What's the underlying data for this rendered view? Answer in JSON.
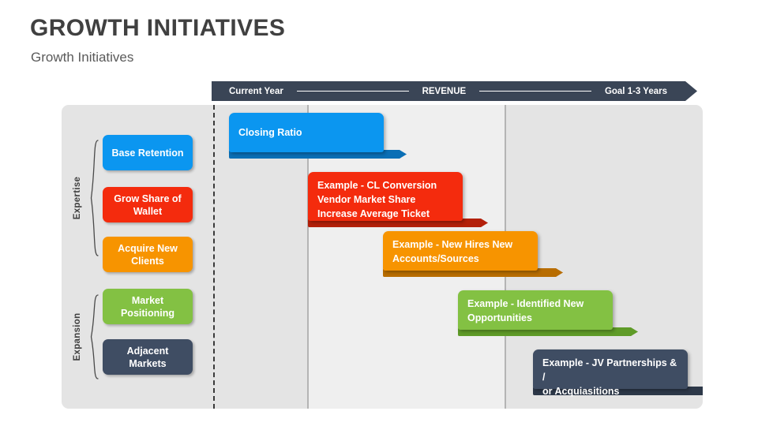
{
  "title": "GROWTH INITIATIVES",
  "subtitle": "Growth Initiatives",
  "banner": {
    "left_label": "Current Year",
    "center_label": "REVENUE",
    "right_label": "Goal 1-3 Years",
    "color": "#3a4556"
  },
  "groups": [
    {
      "label": "Expertise"
    },
    {
      "label": "Expansion"
    }
  ],
  "categories": [
    {
      "label": "Base Retention",
      "color": "#0b96f0",
      "dark": "#0b6fb5"
    },
    {
      "label": "Grow Share of Wallet",
      "color": "#f42b0d",
      "dark": "#b3200a"
    },
    {
      "label": "Acquire New Clients",
      "color": "#f79400",
      "dark": "#b86d00"
    },
    {
      "label": "Market Positioning",
      "color": "#83c143",
      "dark": "#5f9b28"
    },
    {
      "label": "Adjacent Markets",
      "color": "#3f4d63",
      "dark": "#2d3849"
    }
  ],
  "initiatives": [
    {
      "lines": [
        "Closing Ratio"
      ],
      "color": "#0b96f0",
      "dark": "#0b6fb5"
    },
    {
      "lines": [
        "Example - CL Conversion",
        "Vendor Market Share",
        "Increase Average Ticket"
      ],
      "color": "#f42b0d",
      "dark": "#b3200a"
    },
    {
      "lines": [
        "Example - New Hires New",
        "Accounts/Sources"
      ],
      "color": "#f79400",
      "dark": "#b86d00"
    },
    {
      "lines": [
        "Example - Identified New",
        "Opportunities"
      ],
      "color": "#83c143",
      "dark": "#5f9b28"
    },
    {
      "lines": [
        "Example - JV Partnerships & /",
        "or Acquiasitions"
      ],
      "color": "#3f4d63",
      "dark": "#2d3849"
    }
  ],
  "colors": {
    "panel_bg": "#e4e4e4",
    "panel_bg_mid": "#efefef",
    "title": "#404040",
    "subtitle": "#5a5a5a"
  }
}
